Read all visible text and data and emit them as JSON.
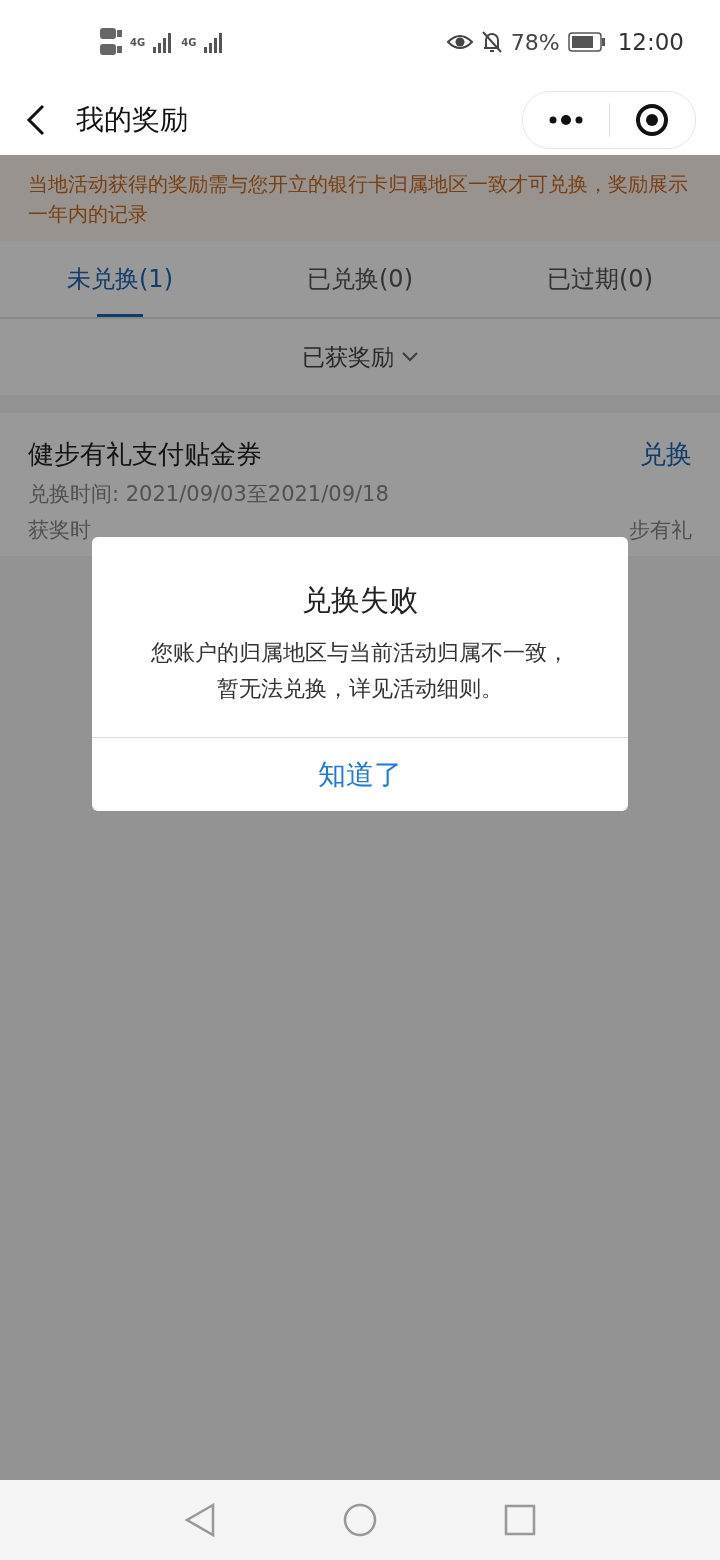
{
  "status_bar": {
    "battery_text": "78%",
    "time": "12:00",
    "network_1": "4G",
    "network_2": "4G"
  },
  "header": {
    "title": "我的奖励"
  },
  "notice": "当地活动获得的奖励需与您开立的银行卡归属地区一致才可兑换，奖励展示一年内的记录",
  "tabs": [
    {
      "label": "未兑换(1)",
      "selected": true
    },
    {
      "label": "已兑换(0)",
      "selected": false
    },
    {
      "label": "已过期(0)",
      "selected": false
    }
  ],
  "filter": {
    "label": "已获奖励"
  },
  "rewards": [
    {
      "name": "健步有礼支付贴金券",
      "action": "兑换",
      "period": "兑换时间: 2021/09/03至2021/09/18",
      "awarded_left": "获奖时",
      "awarded_right": "步有礼"
    }
  ],
  "dialog": {
    "title": "兑换失败",
    "message": "您账户的归属地区与当前活动归属不一致，暂无法兑换，详见活动细则。",
    "button": "知道了"
  }
}
